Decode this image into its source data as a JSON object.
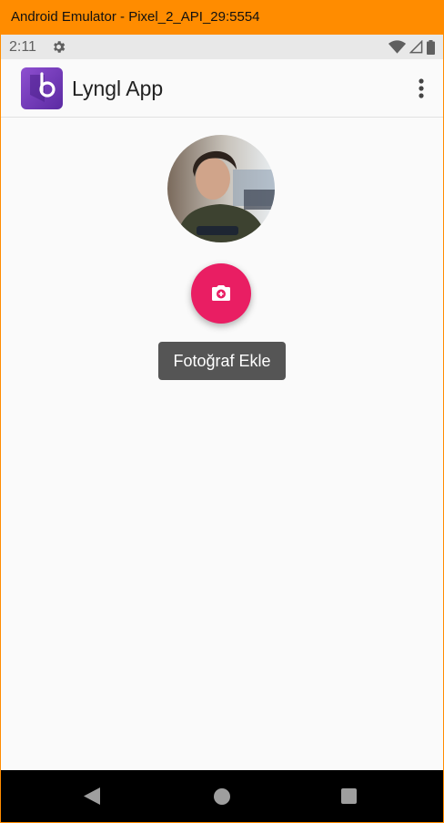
{
  "window": {
    "title": "Android Emulator - Pixel_2_API_29:5554"
  },
  "statusbar": {
    "time": "2:11",
    "settings_icon": "gear-icon",
    "wifi_icon": "wifi-icon",
    "signal_icon": "signal-icon",
    "battery_icon": "battery-icon"
  },
  "appbar": {
    "title": "Lyngl App",
    "logo_icon": "app-logo-icon",
    "menu_icon": "more-vert-icon"
  },
  "main": {
    "avatar": "profile-photo",
    "fab_icon": "add-photo-camera-icon",
    "tooltip": "Fotoğraf Ekle"
  },
  "navbar": {
    "back_icon": "back-icon",
    "home_icon": "home-icon",
    "recents_icon": "recents-icon"
  },
  "colors": {
    "accent": "#e91e63",
    "emulator_frame": "#ff8c00",
    "logo": "#6a35b5",
    "tooltip_bg": "#555555"
  }
}
